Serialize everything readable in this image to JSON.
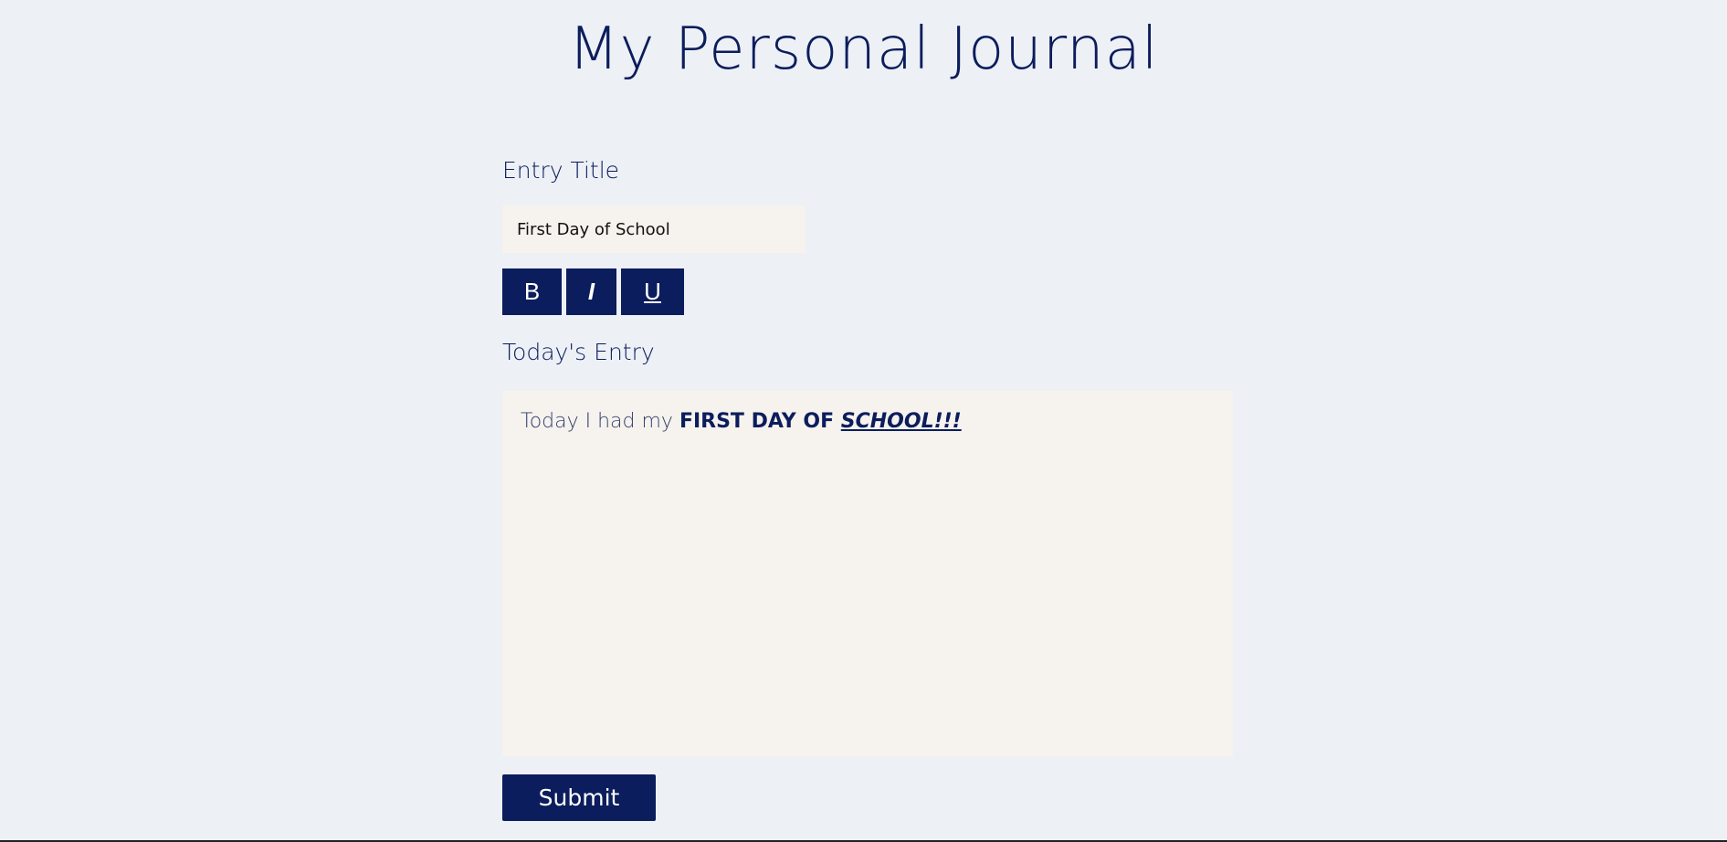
{
  "header": {
    "title": "My Personal Journal"
  },
  "form": {
    "entry_title_label": "Entry Title",
    "entry_title_value": "First Day of School",
    "toolbar": {
      "bold_label": "B",
      "italic_label": "I",
      "underline_label": "U"
    },
    "entry_label": "Today's Entry",
    "entry_content": {
      "plain": "Today I had my ",
      "bold": "FIRST DAY OF ",
      "bold_italic_underline": "SCHOOL!!!"
    },
    "submit_label": "Submit"
  },
  "colors": {
    "background": "#edf0f5",
    "accent": "#0b1d5c",
    "field_background": "#f6f2ed"
  }
}
